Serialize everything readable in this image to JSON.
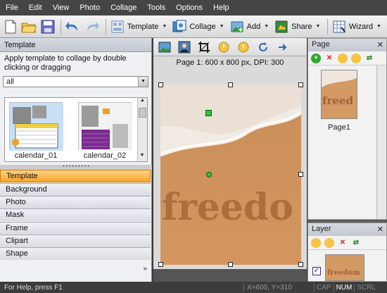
{
  "menu": [
    "File",
    "Edit",
    "View",
    "Photo",
    "Collage",
    "Tools",
    "Options",
    "Help"
  ],
  "toolbar": {
    "template_label": "Template",
    "collage_label": "Collage",
    "add_label": "Add",
    "share_label": "Share",
    "wizard_label": "Wizard"
  },
  "template_panel": {
    "title": "Template",
    "hint": "Apply template to collage by double clicking or dragging",
    "filter_value": "all",
    "thumbnails": [
      {
        "caption": "calendar_01"
      },
      {
        "caption": "calendar_02"
      }
    ]
  },
  "categories": [
    "Template",
    "Background",
    "Photo",
    "Mask",
    "Frame",
    "Clipart",
    "Shape"
  ],
  "active_category": "Template",
  "more_label": "»",
  "page_info": "Page 1: 600 x 800 px, DPI: 300",
  "canvas": {
    "photo_text": "freedo"
  },
  "page_panel": {
    "title": "Page",
    "pages": [
      {
        "caption": "Page1",
        "thumb_text": "freed"
      }
    ]
  },
  "layer_panel": {
    "title": "Layer",
    "thumb_text": "freedom"
  },
  "status": {
    "help": "For Help, press F1",
    "coords": "X=600, Y=310",
    "keys": [
      "CAP",
      "NUM",
      "SCRL"
    ],
    "active_key": "NUM"
  },
  "colors": {
    "accent": "#f6a528",
    "menubar": "#454545"
  }
}
